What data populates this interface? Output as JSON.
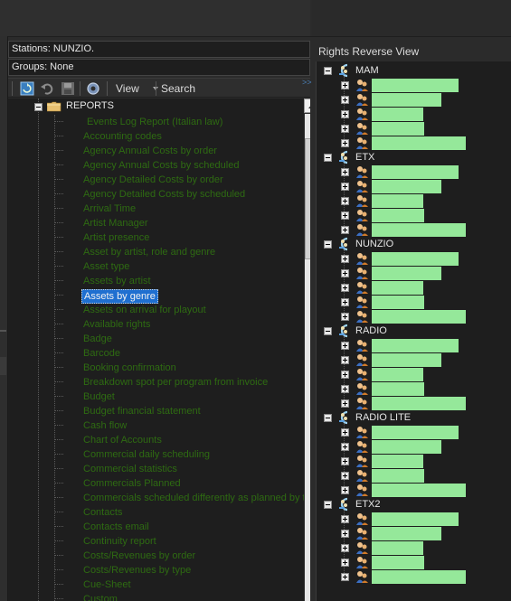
{
  "stations_label": "Stations: NUNZIO.",
  "groups_label": "Groups: None",
  "toolbar": {
    "view_label": "View",
    "search_label": "Search",
    "overflow": ">>"
  },
  "tree": {
    "root_label": "REPORTS",
    "items": [
      "Events Log Report (Italian law)",
      "Accounting codes",
      "Agency Annual Costs by order",
      "Agency Annual Costs by scheduled",
      "Agency Detailed Costs by order",
      "Agency Detailed Costs by scheduled",
      "Arrival Time",
      "Artist Manager",
      "Artist presence",
      "Asset by artist, role and genre",
      "Asset type",
      "Assets by artist",
      "Assets by genre",
      "Assets on arrival for playout",
      "Available rights",
      "Badge",
      "Barcode",
      "Booking confirmation",
      "Breakdown spot per program from invoice",
      "Budget",
      "Budget financial statement",
      "Cash flow",
      "Chart of Accounts",
      "Commercial daily scheduling",
      "Commercial statistics",
      "Commercials Planned",
      "Commercials scheduled differently as planned by time",
      "Contacts",
      "Contacts email",
      "Continuity report",
      "Costs/Revenues by order",
      "Costs/Revenues by type",
      "Cue-Sheet",
      "Custom"
    ],
    "selected_index": 12
  },
  "rights_panel": {
    "title": "Rights Reverse View",
    "groups": [
      {
        "name": "MAM",
        "user_widths": [
          96,
          77,
          57,
          58,
          104
        ]
      },
      {
        "name": "ETX",
        "user_widths": [
          96,
          77,
          57,
          58,
          104
        ]
      },
      {
        "name": "NUNZIO",
        "user_widths": [
          96,
          77,
          57,
          58,
          104
        ]
      },
      {
        "name": "RADIO",
        "user_widths": [
          96,
          77,
          57,
          58,
          104
        ]
      },
      {
        "name": "RADIO LITE",
        "user_widths": [
          96,
          77,
          57,
          58,
          104
        ]
      },
      {
        "name": "ETX2",
        "user_widths": [
          96,
          77,
          57,
          58,
          104
        ]
      }
    ]
  },
  "colors": {
    "item_text": "#2e6b12",
    "selection": "#1f6fd0",
    "user_highlight": "#95e89a",
    "background": "#1e1e1e"
  }
}
